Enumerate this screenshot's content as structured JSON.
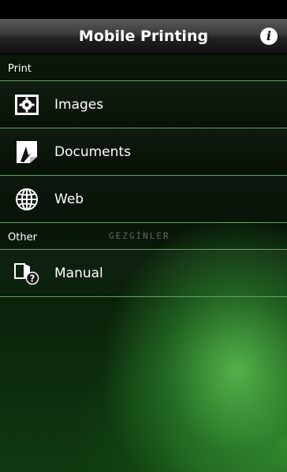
{
  "app": {
    "title": "Mobile Printing",
    "info_icon": "info-icon"
  },
  "sections": {
    "print": {
      "label": "Print",
      "items": [
        {
          "label": "Images",
          "icon": "image-icon"
        },
        {
          "label": "Documents",
          "icon": "document-icon"
        },
        {
          "label": "Web",
          "icon": "globe-icon"
        }
      ]
    },
    "other": {
      "label": "Other",
      "items": [
        {
          "label": "Manual",
          "icon": "manual-icon"
        }
      ]
    }
  },
  "watermark": "GEZGİNLER",
  "colors": {
    "divider": "#6c9f6c",
    "accent_green": "#4fb34a"
  }
}
